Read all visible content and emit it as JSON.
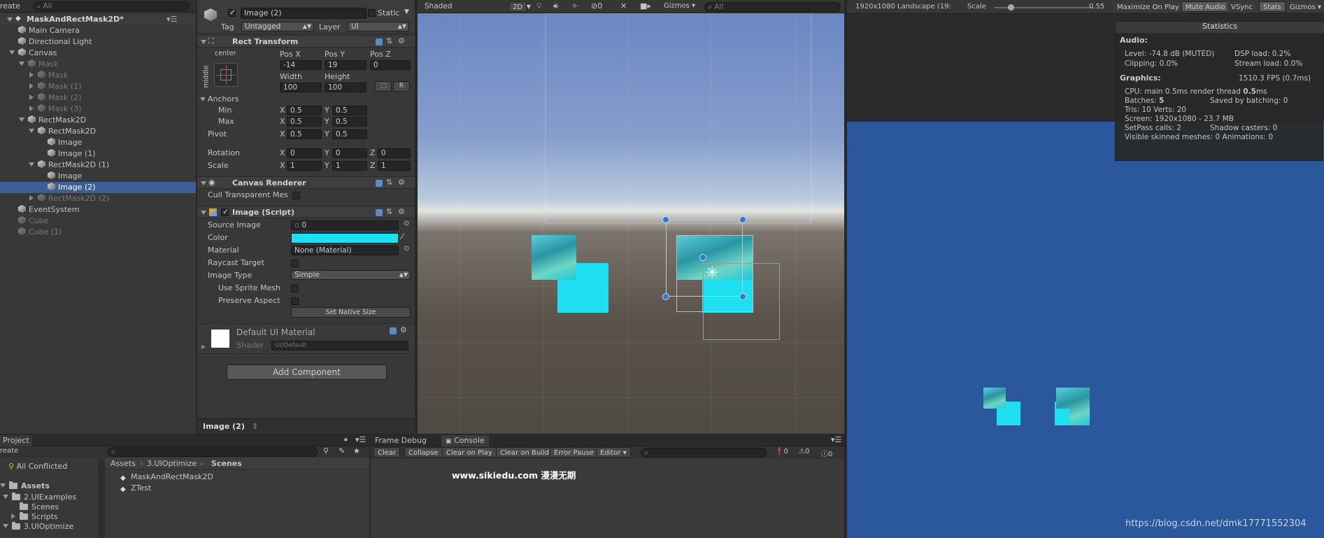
{
  "hierarchy": {
    "create_label": "reate",
    "search_placeholder": "All",
    "scene_name": "MaskAndRectMask2D*",
    "items": [
      {
        "label": "Main Camera",
        "indent": 0,
        "arrow": "none",
        "dim": false,
        "selected": false
      },
      {
        "label": "Directional Light",
        "indent": 0,
        "arrow": "none",
        "dim": false,
        "selected": false
      },
      {
        "label": "Canvas",
        "indent": 0,
        "arrow": "open",
        "dim": false,
        "selected": false
      },
      {
        "label": "Mask",
        "indent": 1,
        "arrow": "open",
        "dim": true,
        "selected": false
      },
      {
        "label": "Mask",
        "indent": 2,
        "arrow": "closed",
        "dim": true,
        "selected": false
      },
      {
        "label": "Mask (1)",
        "indent": 2,
        "arrow": "closed",
        "dim": true,
        "selected": false
      },
      {
        "label": "Mask (2)",
        "indent": 2,
        "arrow": "closed",
        "dim": true,
        "selected": false
      },
      {
        "label": "Mask (3)",
        "indent": 2,
        "arrow": "closed",
        "dim": true,
        "selected": false
      },
      {
        "label": "RectMask2D",
        "indent": 1,
        "arrow": "open",
        "dim": false,
        "selected": false
      },
      {
        "label": "RectMask2D",
        "indent": 2,
        "arrow": "open",
        "dim": false,
        "selected": false
      },
      {
        "label": "Image",
        "indent": 3,
        "arrow": "none",
        "dim": false,
        "selected": false
      },
      {
        "label": "Image (1)",
        "indent": 3,
        "arrow": "none",
        "dim": false,
        "selected": false
      },
      {
        "label": "RectMask2D (1)",
        "indent": 2,
        "arrow": "open",
        "dim": false,
        "selected": false
      },
      {
        "label": "Image",
        "indent": 3,
        "arrow": "none",
        "dim": false,
        "selected": false
      },
      {
        "label": "Image (2)",
        "indent": 3,
        "arrow": "none",
        "dim": false,
        "selected": true
      },
      {
        "label": "RectMask2D (2)",
        "indent": 2,
        "arrow": "closed",
        "dim": true,
        "selected": false
      },
      {
        "label": "EventSystem",
        "indent": 0,
        "arrow": "none",
        "dim": false,
        "selected": false
      },
      {
        "label": "Cube",
        "indent": 0,
        "arrow": "none",
        "dim": true,
        "selected": false
      },
      {
        "label": "Cube (1)",
        "indent": 0,
        "arrow": "none",
        "dim": true,
        "selected": false
      }
    ]
  },
  "inspector": {
    "object_name": "Image (2)",
    "active": true,
    "static_label": "Static",
    "tag_label": "Tag",
    "tag_value": "Untagged",
    "layer_label": "Layer",
    "layer_value": "UI",
    "rect_transform": {
      "title": "Rect Transform",
      "anchor_h": "center",
      "anchor_v": "middle",
      "pos_x_label": "Pos X",
      "pos_y_label": "Pos Y",
      "pos_z_label": "Pos Z",
      "pos_x": "-14",
      "pos_y": "19",
      "pos_z": "0",
      "width_label": "Width",
      "height_label": "Height",
      "width": "100",
      "height": "100",
      "r_button": "R",
      "anchors_label": "Anchors",
      "min_label": "Min",
      "max_label": "Max",
      "min_x": "0.5",
      "min_y": "0.5",
      "max_x": "0.5",
      "max_y": "0.5",
      "pivot_label": "Pivot",
      "pivot_x": "0.5",
      "pivot_y": "0.5",
      "rotation_label": "Rotation",
      "rot_x": "0",
      "rot_y": "0",
      "rot_z": "0",
      "scale_label": "Scale",
      "scale_x": "1",
      "scale_y": "1",
      "scale_z": "1",
      "x": "X",
      "y": "Y",
      "z": "Z"
    },
    "canvas_renderer": {
      "title": "Canvas Renderer",
      "cull_label": "Cull Transparent Mes"
    },
    "image_script": {
      "title": "Image (Script)",
      "source_image_label": "Source Image",
      "source_image_value": "0",
      "color_label": "Color",
      "color_value": "#1fe0f0",
      "material_label": "Material",
      "material_value": "None (Material)",
      "raycast_label": "Raycast Target",
      "image_type_label": "Image Type",
      "image_type_value": "Simple",
      "use_sprite_mesh_label": "Use Sprite Mesh",
      "preserve_aspect_label": "Preserve Aspect",
      "set_native_size": "Set Native Size"
    },
    "material": {
      "name": "Default UI Material",
      "shader_label": "Shader",
      "shader_value": "UI/Default"
    },
    "add_component": "Add Component",
    "footer_label": "Image (2)"
  },
  "scene_view": {
    "shading_mode": "Shaded",
    "mode_2d": "2D",
    "hidden_count": "0",
    "gizmos_label": "Gizmos",
    "search_placeholder": "All"
  },
  "game_view": {
    "resolution": "1920x1080 Landscape (19:",
    "scale_label": "Scale",
    "scale_value": "0.55",
    "maximize_on_play": "Maximize On Play",
    "mute_audio": "Mute Audio",
    "vsync": "VSync",
    "stats": "Stats",
    "gizmos": "Gizmos",
    "bg_color": "#2b579c"
  },
  "statistics": {
    "title": "Statistics",
    "audio_label": "Audio:",
    "audio_lines": [
      "Level: -74.8 dB (MUTED)",
      "DSP load: 0.2%",
      "Clipping: 0.0%",
      "Stream load: 0.0%"
    ],
    "graphics_label": "Graphics:",
    "fps": "1510.3 FPS (0.7ms)",
    "cpu_prefix": "CPU: main 0.5ms  render thread ",
    "cpu_bold": "0.5",
    "cpu_suffix": "ms",
    "batches_prefix": "Batches: ",
    "batches_bold": "5",
    "saved_batching": "Saved by batching: 0",
    "tris": "Tris: 10   Verts: 20",
    "screen": "Screen: 1920x1080 - 23.7 MB",
    "setpass": "SetPass calls: 2",
    "shadow": "Shadow casters: 0",
    "skinned": "Visible skinned meshes: 0  Animations: 0"
  },
  "project": {
    "tab_label": "Project",
    "create_label": "reate",
    "all_conflicted": "All Conflicted",
    "assets_root": "Assets",
    "tree": [
      "2.UIExamples",
      "Scenes",
      "Scripts",
      "3.UIOptimize"
    ],
    "breadcrumb": [
      "Assets",
      "3.UIOptimize",
      "Scenes"
    ],
    "files": [
      "MaskAndRectMask2D",
      "ZTest"
    ]
  },
  "console": {
    "frame_debug_tab": "Frame Debug",
    "console_tab": "Console",
    "clear": "Clear",
    "collapse": "Collapse",
    "clear_on_play": "Clear on Play",
    "clear_on_build": "Clear on Build",
    "error_pause": "Error Pause",
    "editor": "Editor",
    "info_count": "0",
    "warn_count": "0",
    "error_count": "0"
  },
  "watermarks": {
    "sikiedu": "www.sikiedu.com 漫漫无期",
    "csdn": "https://blog.csdn.net/dmk17771552304"
  }
}
